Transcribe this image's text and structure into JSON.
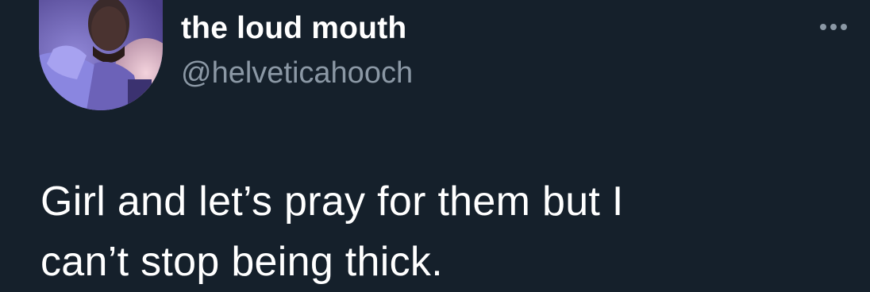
{
  "tweet": {
    "author": {
      "display_name": "the loud mouth",
      "handle": "@helveticahooch",
      "avatar_icon": "profile-photo"
    },
    "text_lines": [
      "Girl and let’s pray for them but I",
      "can’t stop being thick."
    ],
    "more_icon": "ellipsis-icon"
  },
  "colors": {
    "background": "#15202b",
    "name": "#ffffff",
    "handle": "#8b98a5",
    "text": "#ffffff"
  }
}
